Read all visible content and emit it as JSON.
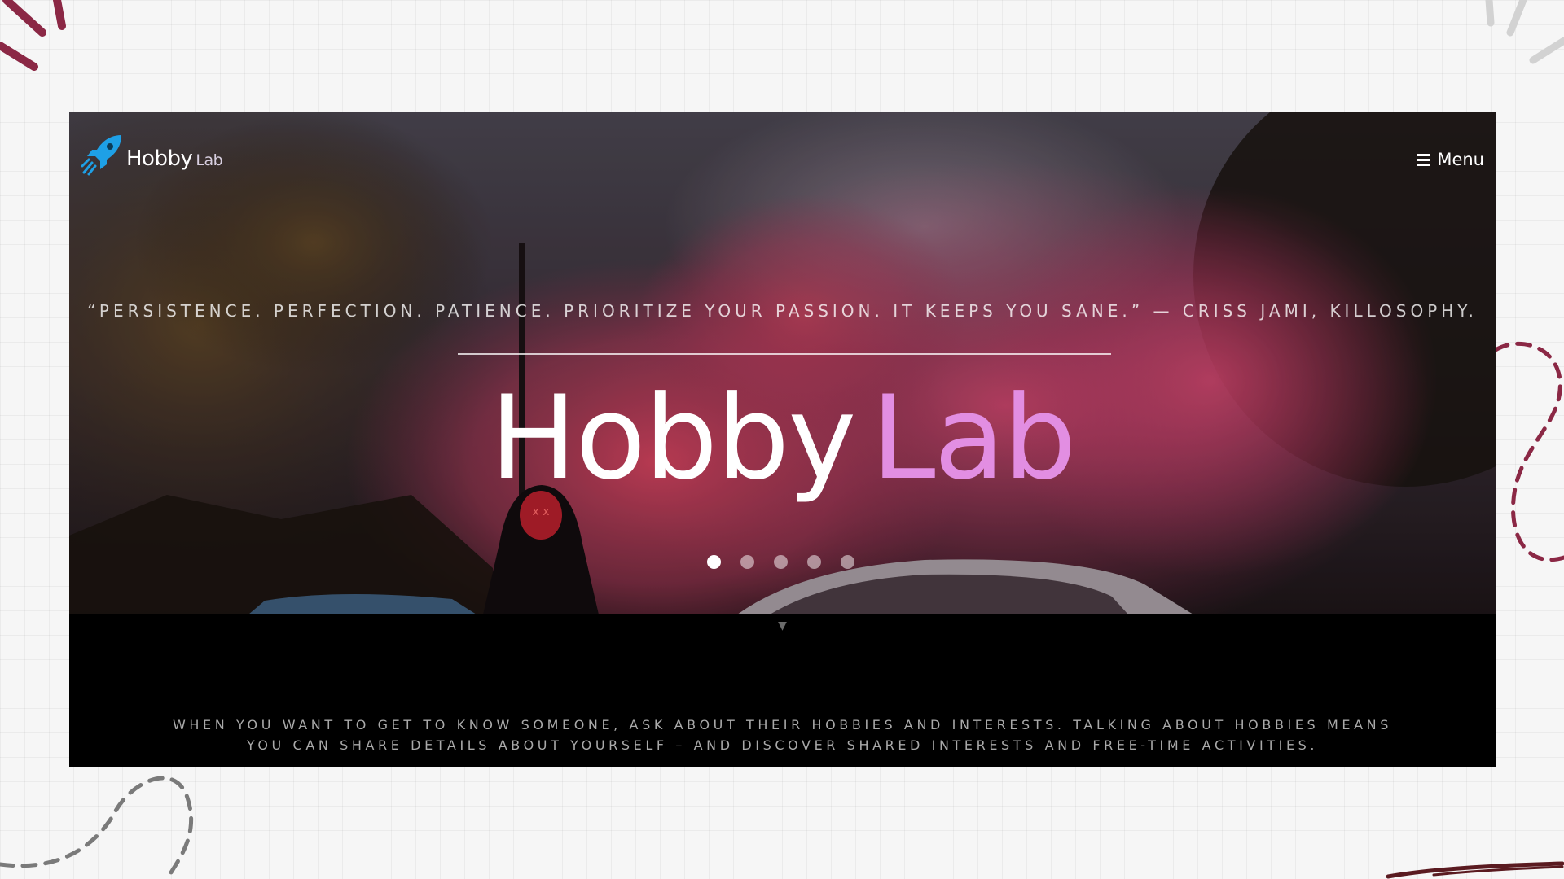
{
  "brand": {
    "name": "Hobby",
    "name_suffix": "Lab",
    "logo_icon": "rocket-icon",
    "logo_color": "#1ea0e6"
  },
  "nav": {
    "menu_label": "Menu",
    "menu_icon": "hamburger-icon"
  },
  "hero": {
    "quote": "“PERSISTENCE. PERFECTION. PATIENCE. PRIORITIZE YOUR PASSION. IT KEEPS YOU SANE.” — CRISS JAMI, KILLOSOPHY.",
    "title_main": "Hobby",
    "title_accent": "Lab",
    "accent_color": "#e28ee2",
    "slides": {
      "count": 5,
      "active_index": 0
    }
  },
  "scroll_indicator": {
    "icon": "triangle-down-icon"
  },
  "intro": {
    "text": "WHEN YOU WANT TO GET TO KNOW SOMEONE, ASK ABOUT THEIR HOBBIES AND INTERESTS. TALKING ABOUT HOBBIES MEANS YOU CAN SHARE DETAILS ABOUT YOURSELF – AND DISCOVER SHARED INTERESTS AND FREE-TIME ACTIVITIES."
  },
  "colors": {
    "decor_maroon": "#8b2845",
    "decor_gray": "#7a7a7a",
    "background": "#f6f6f6"
  }
}
